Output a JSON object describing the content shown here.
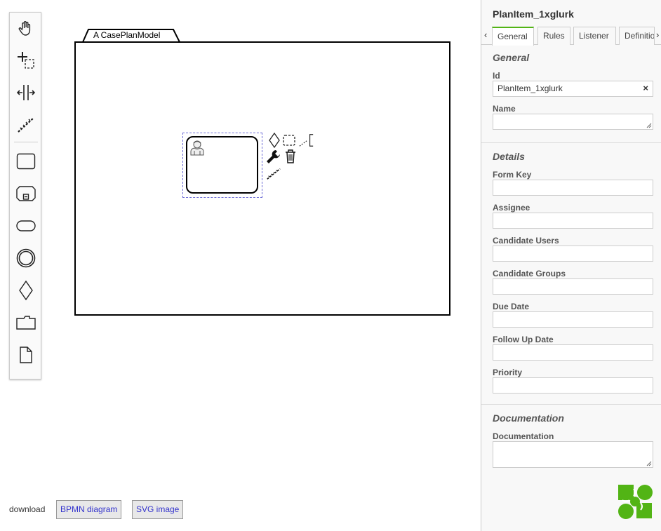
{
  "palette": {
    "tools": [
      {
        "name": "hand-tool-icon"
      },
      {
        "name": "lasso-tool-icon"
      },
      {
        "name": "space-tool-icon"
      },
      {
        "name": "connect-tool-icon"
      },
      {
        "name": "create-task-icon"
      },
      {
        "name": "create-stage-icon"
      },
      {
        "name": "create-event-listener-icon"
      },
      {
        "name": "create-milestone-icon"
      },
      {
        "name": "create-criterion-icon"
      },
      {
        "name": "create-case-file-icon"
      },
      {
        "name": "create-document-icon"
      }
    ]
  },
  "canvas": {
    "case_plan_model_label": "A CasePlanModel"
  },
  "download": {
    "label": "download",
    "bpmn_button": "BPMN diagram",
    "svg_button": "SVG image"
  },
  "properties": {
    "title": "PlanItem_1xglurk",
    "tabs": [
      "General",
      "Rules",
      "Listener",
      "Definitio"
    ],
    "active_tab": "General",
    "groups": {
      "general": {
        "title": "General",
        "id_label": "Id",
        "id_value": "PlanItem_1xglurk",
        "clear": "×",
        "name_label": "Name",
        "name_value": ""
      },
      "details": {
        "title": "Details",
        "form_key_label": "Form Key",
        "assignee_label": "Assignee",
        "candidate_users_label": "Candidate Users",
        "candidate_groups_label": "Candidate Groups",
        "due_date_label": "Due Date",
        "follow_up_date_label": "Follow Up Date",
        "priority_label": "Priority"
      },
      "documentation": {
        "title": "Documentation",
        "documentation_label": "Documentation",
        "documentation_value": ""
      }
    }
  },
  "colors": {
    "accent": "#52b415",
    "selection": "#6b6bd6",
    "link": "#3333cc"
  }
}
